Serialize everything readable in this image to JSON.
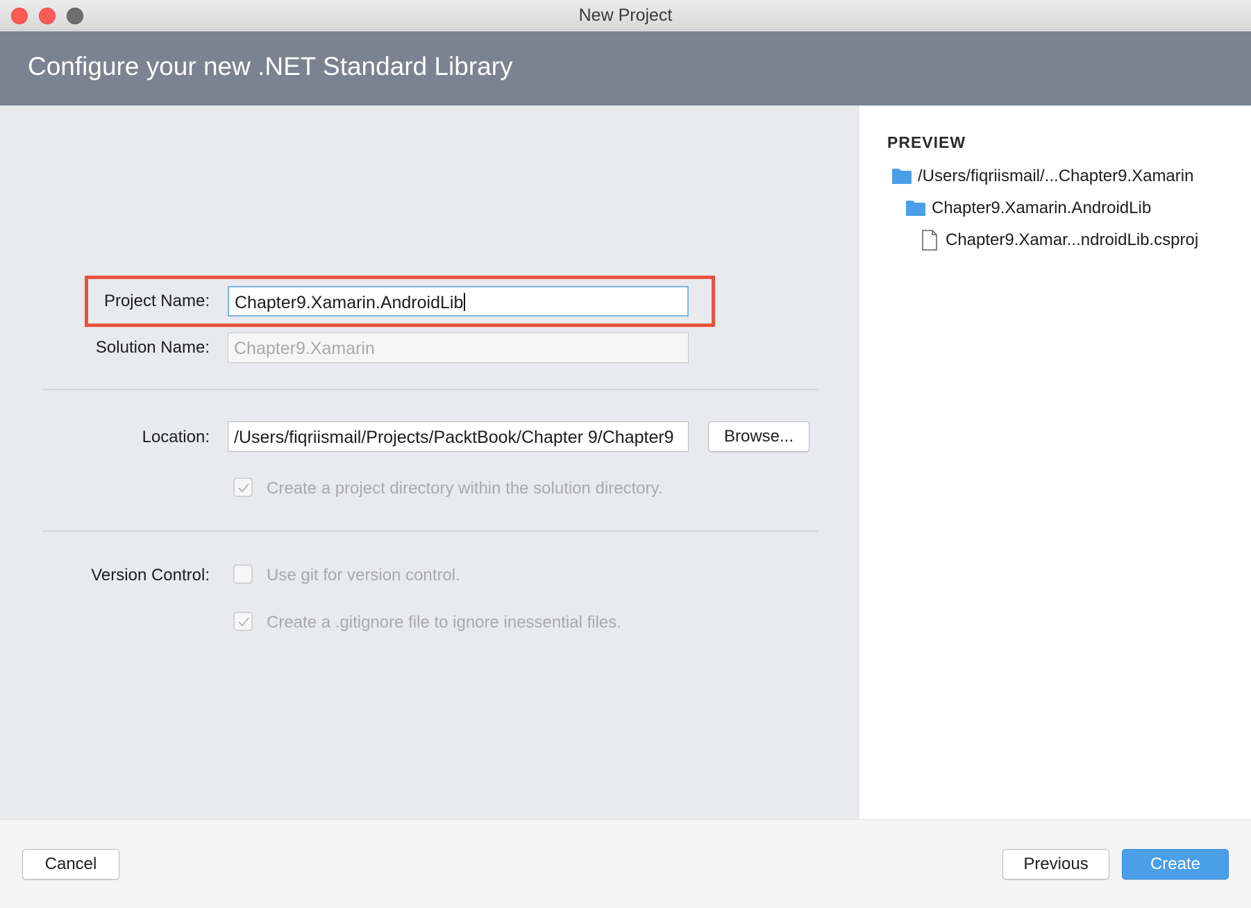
{
  "window": {
    "title": "New Project"
  },
  "banner": {
    "title": "Configure your new .NET Standard Library"
  },
  "form": {
    "project_name_label": "Project Name:",
    "project_name_value": "Chapter9.Xamarin.AndroidLib",
    "solution_name_label": "Solution Name:",
    "solution_name_value": "Chapter9.Xamarin",
    "location_label": "Location:",
    "location_value": "/Users/fiqriismail/Projects/PacktBook/Chapter 9/Chapter9",
    "browse_label": "Browse...",
    "create_dir_label": "Create a project directory within the solution directory.",
    "create_dir_checked": true,
    "version_control_label": "Version Control:",
    "use_git_label": "Use git for version control.",
    "use_git_checked": false,
    "gitignore_label": "Create a .gitignore file to ignore inessential files.",
    "gitignore_checked": true
  },
  "preview": {
    "heading": "PREVIEW",
    "items": [
      {
        "label": "/Users/fiqriismail/...Chapter9.Xamarin",
        "icon": "folder-icon"
      },
      {
        "label": "Chapter9.Xamarin.AndroidLib",
        "icon": "folder-icon"
      },
      {
        "label": "Chapter9.Xamar...ndroidLib.csproj",
        "icon": "file-icon"
      }
    ]
  },
  "footer": {
    "cancel_label": "Cancel",
    "previous_label": "Previous",
    "create_label": "Create"
  },
  "colors": {
    "banner": "#7a838f",
    "highlight": "#e8533f",
    "primary_button": "#4a9fe8",
    "folder": "#4a9fe8"
  }
}
